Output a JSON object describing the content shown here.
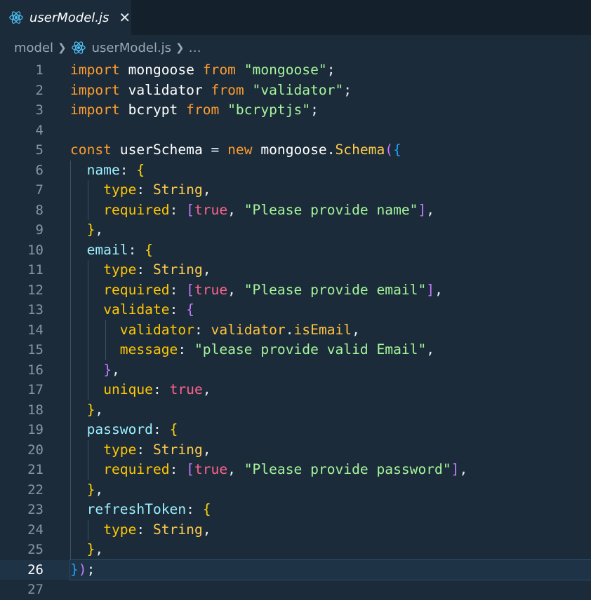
{
  "tab": {
    "file_name": "userModel.js",
    "close_glyph": "✕",
    "icon": "react-icon"
  },
  "breadcrumb": {
    "folder": "model",
    "file": "userModel.js",
    "more": "…"
  },
  "editor": {
    "current_line": 26,
    "line_numbers": [
      "1",
      "2",
      "3",
      "4",
      "5",
      "6",
      "7",
      "8",
      "9",
      "10",
      "11",
      "12",
      "13",
      "14",
      "15",
      "16",
      "17",
      "18",
      "19",
      "20",
      "21",
      "22",
      "23",
      "24",
      "25",
      "26",
      "27"
    ],
    "lines": [
      "import mongoose from \"mongoose\";",
      "import validator from \"validator\";",
      "import bcrypt from \"bcryptjs\";",
      "",
      "const userSchema = new mongoose.Schema({",
      "  name: {",
      "    type: String,",
      "    required: [true, \"Please provide name\"],",
      "  },",
      "  email: {",
      "    type: String,",
      "    required: [true, \"Please provide email\"],",
      "    validate: {",
      "      validator: validator.isEmail,",
      "      message: \"please provide valid Email\",",
      "    },",
      "    unique: true,",
      "  },",
      "  password: {",
      "    type: String,",
      "    required: [true, \"Please provide password\"],",
      "  },",
      "  refreshToken: {",
      "    type: String,",
      "  },",
      "});",
      ""
    ]
  },
  "colors": {
    "background": "#1b2b3a",
    "keyword": "#ff9d2e",
    "string": "#a5f59a",
    "property": "#9ef0ff",
    "boolean": "#ff628c",
    "bracket_1": "#c37bff",
    "bracket_2": "#1e9fff",
    "bracket_3": "#ffd20d"
  }
}
